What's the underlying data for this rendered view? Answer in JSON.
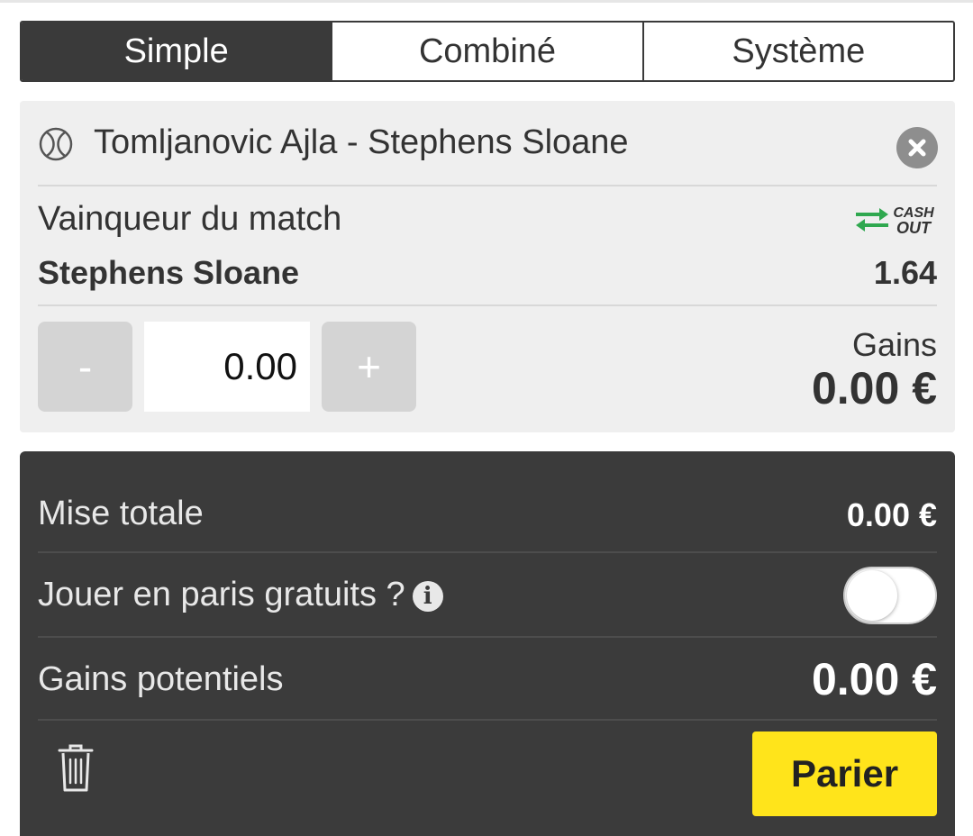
{
  "tabs": [
    {
      "label": "Simple",
      "active": true
    },
    {
      "label": "Combiné",
      "active": false
    },
    {
      "label": "Système",
      "active": false
    }
  ],
  "bet": {
    "match": "Tomljanovic Ajla - Stephens Sloane",
    "market": "Vainqueur du match",
    "selection": "Stephens Sloane",
    "odds": "1.64",
    "cashout_badge_line1": "CASH",
    "cashout_badge_line2": "OUT",
    "stake_minus": "-",
    "stake_plus": "+",
    "stake_value": "0.00",
    "gains_label": "Gains",
    "gains_value": "0.00 €"
  },
  "summary": {
    "total_stake_label": "Mise totale",
    "total_stake_value": "0.00 €",
    "free_bets_label": "Jouer en paris gratuits ?",
    "free_bets_info": "i",
    "free_bets_enabled": false,
    "potential_gains_label": "Gains potentiels",
    "potential_gains_value": "0.00 €",
    "bet_button": "Parier"
  },
  "colors": {
    "dark": "#3b3b3b",
    "accent_yellow": "#ffe41b",
    "cashout_green": "#2fa84f",
    "card_bg": "#efefef"
  },
  "icons": [
    "tennis-ball-icon",
    "close-circle-icon",
    "cashout-arrows-icon",
    "info-icon",
    "trash-icon"
  ]
}
